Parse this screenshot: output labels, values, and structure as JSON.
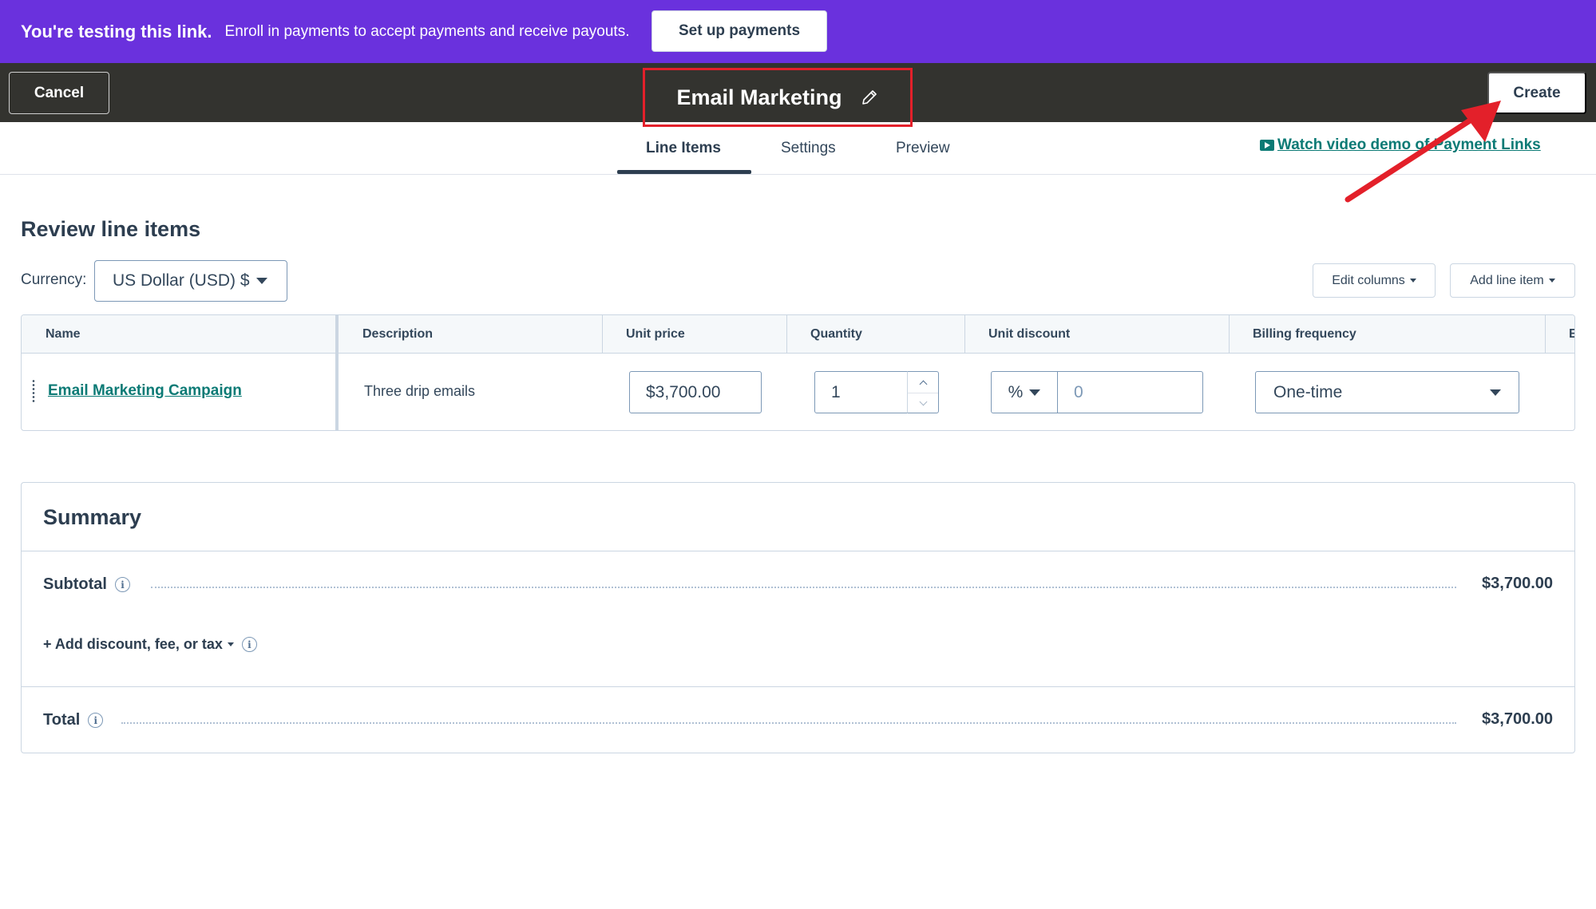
{
  "banner": {
    "title": "You're testing this link.",
    "text": "Enroll in payments to accept payments and receive payouts.",
    "button": "Set up payments",
    "bg_color": "#6a31dd"
  },
  "topbar": {
    "cancel": "Cancel",
    "title": "Email Marketing",
    "edit_icon": "pencil-icon",
    "create": "Create"
  },
  "tabs": [
    {
      "label": "Line Items",
      "active": true
    },
    {
      "label": "Settings",
      "active": false
    },
    {
      "label": "Preview",
      "active": false
    }
  ],
  "video_link": "Watch video demo of Payment Links",
  "review": {
    "title": "Review line items",
    "currency_label": "Currency:",
    "currency_value": "US Dollar (USD) $",
    "edit_columns": "Edit columns",
    "add_line_item": "Add line item"
  },
  "table": {
    "headers": [
      "Name",
      "Description",
      "Unit price",
      "Quantity",
      "Unit discount",
      "Billing frequency",
      "E"
    ],
    "rows": [
      {
        "name": "Email Marketing Campaign",
        "description": "Three drip emails",
        "unit_price": "$3,700.00",
        "quantity": "1",
        "discount_type": "%",
        "discount_value": "0",
        "billing_frequency": "One-time"
      }
    ]
  },
  "summary": {
    "title": "Summary",
    "subtotal_label": "Subtotal",
    "subtotal_value": "$3,700.00",
    "add_link": "+ Add discount, fee, or tax",
    "total_label": "Total",
    "total_value": "$3,700.00"
  },
  "colors": {
    "accent_link": "#0b7a75",
    "annotation_red": "#e3202a",
    "topbar": "#33332f"
  }
}
